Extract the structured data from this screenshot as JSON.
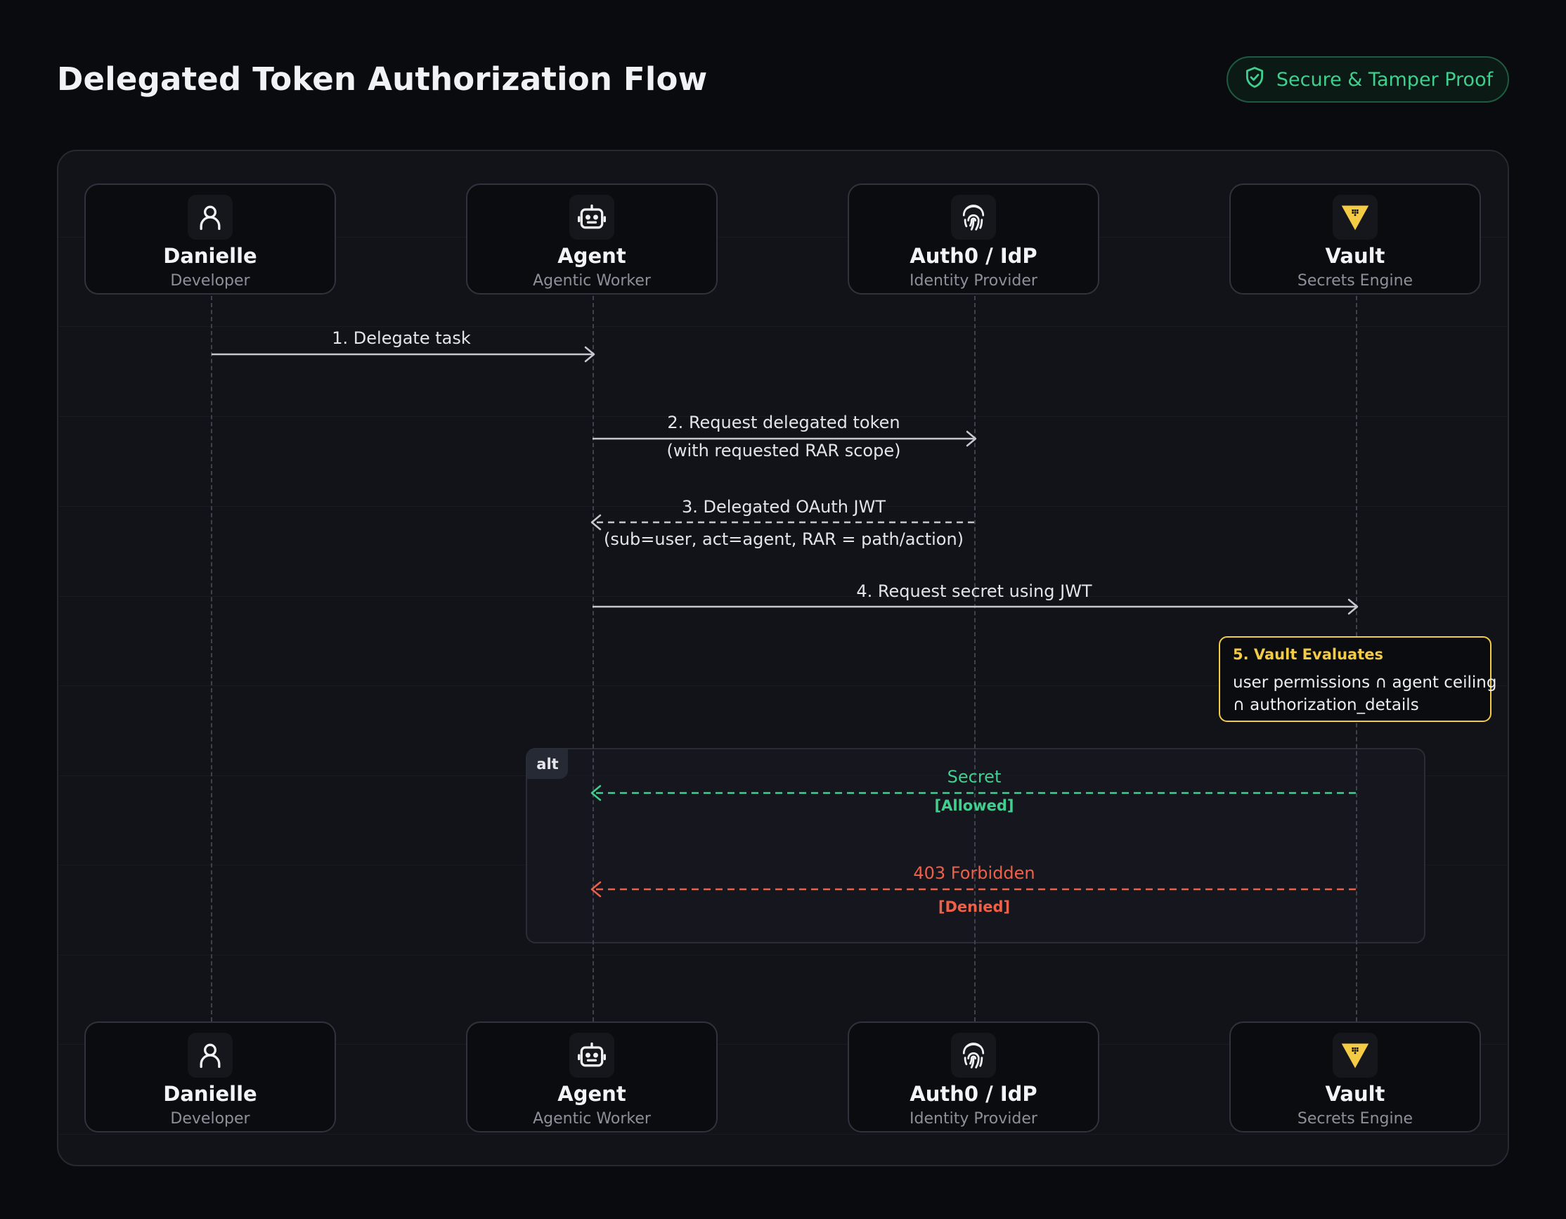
{
  "header": {
    "title": "Delegated Token Authorization Flow",
    "badge": "Secure & Tamper Proof",
    "badge_icon": "shield-check-icon",
    "badge_color": "#3fcf8e"
  },
  "actors": [
    {
      "id": "danielle",
      "name": "Danielle",
      "role": "Developer",
      "icon": "user-icon"
    },
    {
      "id": "agent",
      "name": "Agent",
      "role": "Agentic Worker",
      "icon": "robot-icon"
    },
    {
      "id": "auth0",
      "name": "Auth0 / IdP",
      "role": "Identity Provider",
      "icon": "fingerprint-icon"
    },
    {
      "id": "vault",
      "name": "Vault",
      "role": "Secrets Engine",
      "icon": "vault-triangle-icon",
      "icon_color": "#f4cb45"
    }
  ],
  "messages": [
    {
      "from": "danielle",
      "to": "agent",
      "label": "1. Delegate task",
      "style": "solid"
    },
    {
      "from": "agent",
      "to": "auth0",
      "label": "2. Request delegated token",
      "sublabel": "(with requested RAR scope)",
      "style": "solid"
    },
    {
      "from": "auth0",
      "to": "agent",
      "label": "3. Delegated OAuth JWT",
      "sublabel": "(sub=user, act=agent, RAR = path/action)",
      "style": "dashed"
    },
    {
      "from": "agent",
      "to": "vault",
      "label": "4. Request secret using JWT",
      "style": "solid"
    }
  ],
  "evaluation": {
    "title": "5. Vault Evaluates",
    "line1": "user permissions ∩ agent ceiling",
    "line2": "∩ authorization_details",
    "color": "#f4cb45"
  },
  "alt": {
    "label": "alt",
    "branches": [
      {
        "from": "vault",
        "to": "agent",
        "label": "Secret",
        "condition": "[Allowed]",
        "color": "#3fcf8e"
      },
      {
        "from": "vault",
        "to": "agent",
        "label": "403 Forbidden",
        "condition": "[Denied]",
        "color": "#ef6048"
      }
    ]
  }
}
